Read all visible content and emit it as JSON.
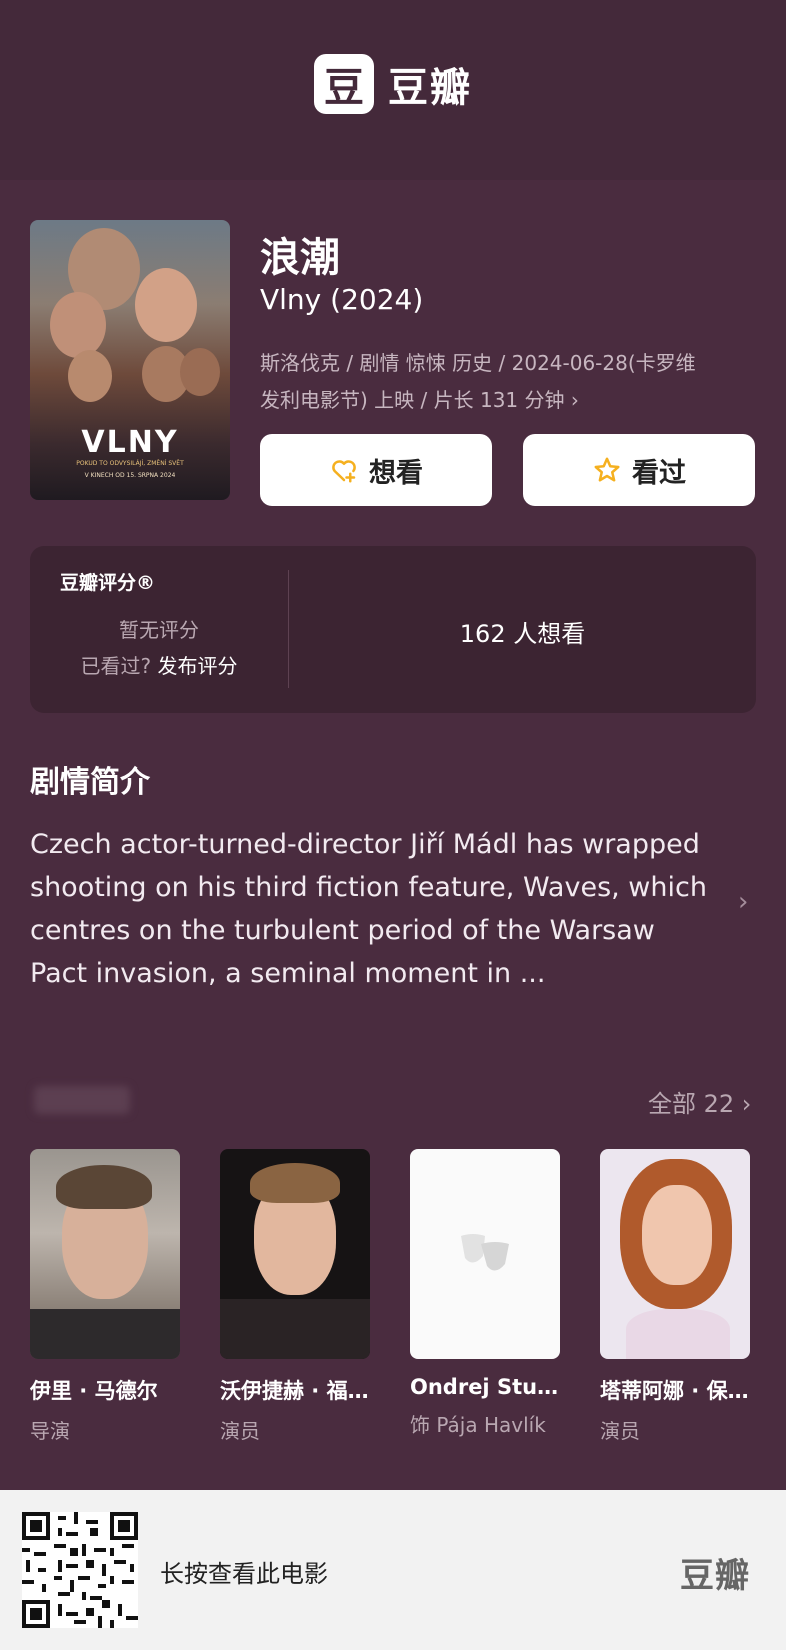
{
  "brand": {
    "logo_char": "豆",
    "logo_text": "豆瓣"
  },
  "movie": {
    "title_cn": "浪潮",
    "title_en": "Vlny (2024)",
    "meta_line1": "斯洛伐克 / 剧情 惊悚 历史 / 2024-06-28(卡罗维",
    "meta_line2": "发利电影节) 上映 / 片长 131 分钟",
    "poster": {
      "title": "VLNY",
      "tagline": "POKUD TO ODVYSILÁJÍ, ZMĚNÍ SVĚT",
      "date": "V KINECH OD 15. SRPNA 2024"
    }
  },
  "actions": {
    "want_label": "想看",
    "seen_label": "看过"
  },
  "rating": {
    "label": "豆瓣评分®",
    "none_text": "暂无评分",
    "prompt_text": "已看过?",
    "prompt_link": "发布评分",
    "want_count_text": "162 人想看"
  },
  "synopsis": {
    "title": "剧情简介",
    "text": "Czech actor-turned-director Jiří Mádl has wrapped shooting on his third fiction feature, Waves, which centres on the turbulent period of the Warsaw Pact invasion, a seminal moment in ..."
  },
  "cast": {
    "all_label": "全部 22",
    "members": [
      {
        "name": "伊里 · 马德尔",
        "role": "导演"
      },
      {
        "name": "沃伊捷赫 · 福...",
        "role": "演员"
      },
      {
        "name": "Ondrej Stupka",
        "role": "饰 Pája Havlík"
      },
      {
        "name": "塔蒂阿娜 · 保...",
        "role": "演员"
      }
    ]
  },
  "footer": {
    "text": "长按查看此电影",
    "logo": "豆瓣"
  },
  "colors": {
    "background": "#4a2c3f",
    "header": "#44293a",
    "card": "#3c2432",
    "accent_star": "#f5b01f"
  }
}
